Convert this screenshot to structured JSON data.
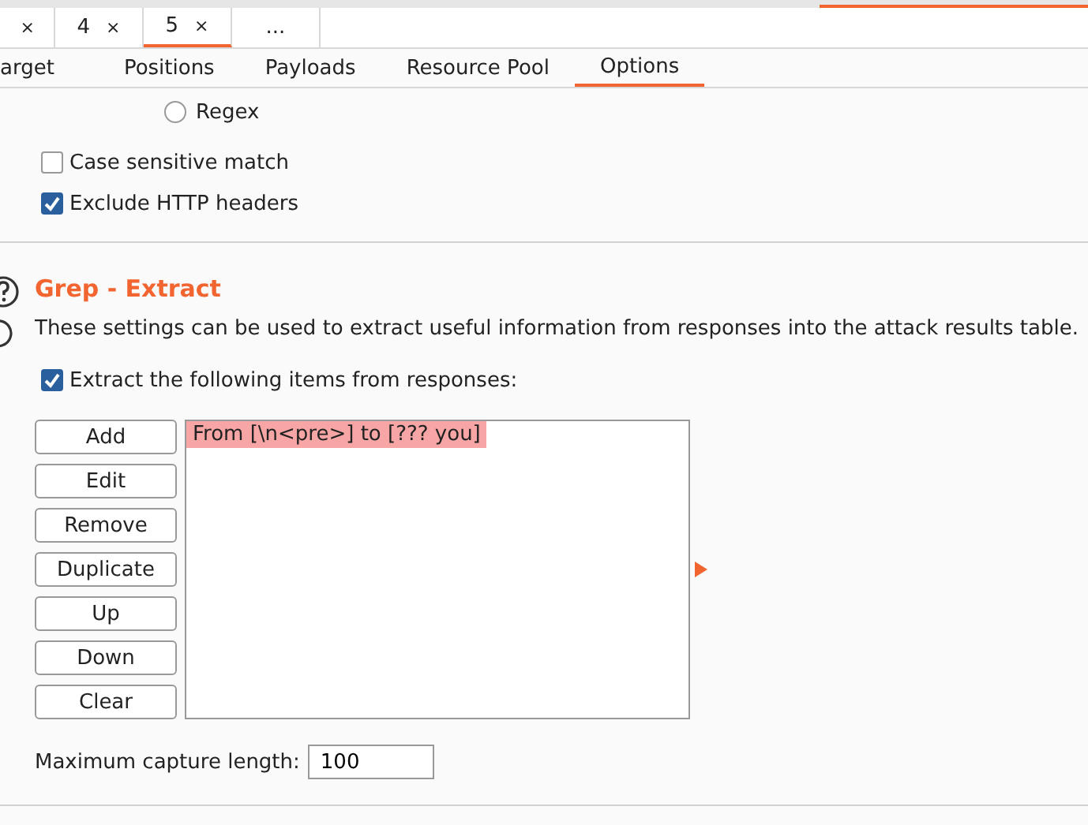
{
  "request_tabs": [
    {
      "close": "×",
      "selected": false
    },
    {
      "label": "4",
      "close": "×",
      "selected": false
    },
    {
      "label": "5",
      "close": "×",
      "selected": true
    },
    {
      "label": "...",
      "selected": false
    }
  ],
  "sub_tabs": [
    {
      "label": "arget",
      "selected": false
    },
    {
      "label": "Positions",
      "selected": false
    },
    {
      "label": "Payloads",
      "selected": false
    },
    {
      "label": "Resource Pool",
      "selected": false
    },
    {
      "label": "Options",
      "selected": true
    }
  ],
  "match_type": {
    "label": "Regex",
    "selected": false
  },
  "options": [
    {
      "label": "Case sensitive match",
      "checked": false
    },
    {
      "label": "Exclude HTTP headers",
      "checked": true
    }
  ],
  "section": {
    "title": "Grep - Extract",
    "description": "These settings can be used to extract useful information from responses into the attack results table.",
    "enable": {
      "label": "Extract the following items from responses:",
      "checked": true
    },
    "buttons": [
      "Add",
      "Edit",
      "Remove",
      "Duplicate",
      "Up",
      "Down",
      "Clear"
    ],
    "items": [
      {
        "text": "From [\\n<pre>] to [??? you]",
        "selected": true
      }
    ],
    "max_capture": {
      "label": "Maximum capture length:",
      "value": "100"
    }
  }
}
